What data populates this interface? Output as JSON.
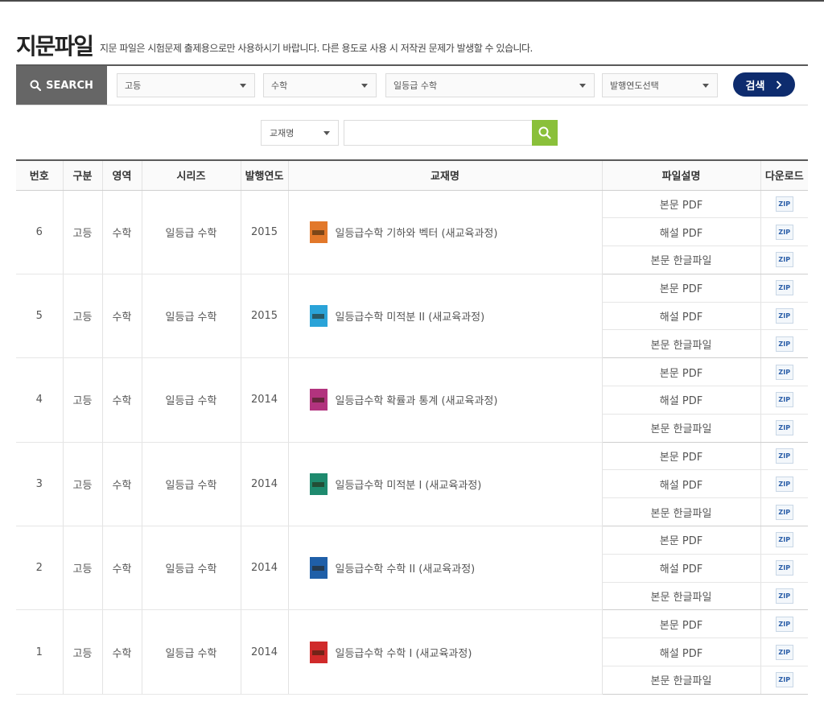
{
  "header": {
    "title": "지문파일",
    "description": "지문 파일은 시험문제 출제용으로만 사용하시기 바랍니다. 다른 용도로 사용 시 저작권 문제가 발생할 수 있습니다."
  },
  "search": {
    "label": "SEARCH",
    "filters": [
      "고등",
      "수학",
      "일등급 수학",
      "발행연도선택"
    ],
    "button_label": "검색",
    "keyword_type": "교재명",
    "keyword_value": ""
  },
  "table": {
    "headers": [
      "번호",
      "구분",
      "영역",
      "시리즈",
      "발행연도",
      "교재명",
      "파일설명",
      "다운로드"
    ],
    "rows": [
      {
        "no": "6",
        "level": "고등",
        "subject": "수학",
        "series": "일등급 수학",
        "year": "2015",
        "title": "일등급수학 기하와 벡터 (새교육과정)",
        "cover_color": "#e2782a",
        "files": [
          "본문 PDF",
          "해설 PDF",
          "본문 한글파일"
        ]
      },
      {
        "no": "5",
        "level": "고등",
        "subject": "수학",
        "series": "일등급 수학",
        "year": "2015",
        "title": "일등급수학 미적분 II (새교육과정)",
        "cover_color": "#2aa3d8",
        "files": [
          "본문 PDF",
          "해설 PDF",
          "본문 한글파일"
        ]
      },
      {
        "no": "4",
        "level": "고등",
        "subject": "수학",
        "series": "일등급 수학",
        "year": "2014",
        "title": "일등급수학 확률과 통계 (새교육과정)",
        "cover_color": "#b2337e",
        "files": [
          "본문 PDF",
          "해설 PDF",
          "본문 한글파일"
        ]
      },
      {
        "no": "3",
        "level": "고등",
        "subject": "수학",
        "series": "일등급 수학",
        "year": "2014",
        "title": "일등급수학 미적분 I (새교육과정)",
        "cover_color": "#1e8a6e",
        "files": [
          "본문 PDF",
          "해설 PDF",
          "본문 한글파일"
        ]
      },
      {
        "no": "2",
        "level": "고등",
        "subject": "수학",
        "series": "일등급 수학",
        "year": "2014",
        "title": "일등급수학 수학 II (새교육과정)",
        "cover_color": "#1f5fa8",
        "files": [
          "본문 PDF",
          "해설 PDF",
          "본문 한글파일"
        ]
      },
      {
        "no": "1",
        "level": "고등",
        "subject": "수학",
        "series": "일등급 수학",
        "year": "2014",
        "title": "일등급수학 수학 I (새교육과정)",
        "cover_color": "#d02a2a",
        "files": [
          "본문 PDF",
          "해설 PDF",
          "본문 한글파일"
        ]
      }
    ],
    "download_label": "ZIP"
  },
  "colors": {
    "search_button": "#0e2c6e",
    "keyword_button": "#8ac03a",
    "search_label_bg": "#666666"
  }
}
